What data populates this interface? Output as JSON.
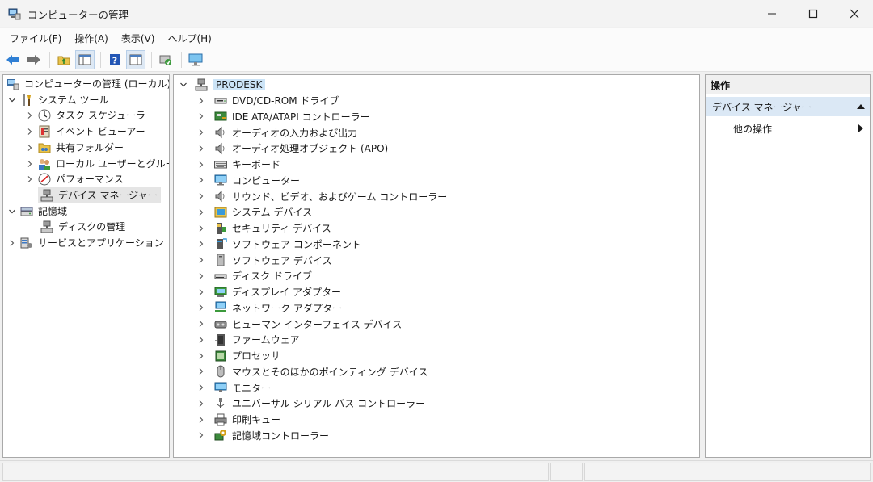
{
  "window": {
    "title": "コンピューターの管理"
  },
  "menu": [
    {
      "label": "ファイル(F)"
    },
    {
      "label": "操作(A)"
    },
    {
      "label": "表示(V)"
    },
    {
      "label": "ヘルプ(H)"
    }
  ],
  "left_tree": {
    "root": "コンピューターの管理 (ローカル)",
    "system_tools": "システム ツール",
    "task_scheduler": "タスク スケジューラ",
    "event_viewer": "イベント ビューアー",
    "shared_folders": "共有フォルダー",
    "local_users": "ローカル ユーザーとグループ",
    "performance": "パフォーマンス",
    "device_manager": "デバイス マネージャー",
    "storage": "記憶域",
    "disk_management": "ディスクの管理",
    "services_apps": "サービスとアプリケーション"
  },
  "device_tree": {
    "root": "PRODESK",
    "categories": [
      {
        "label": "DVD/CD-ROM ドライブ",
        "icon": "dvd-drive-icon"
      },
      {
        "label": "IDE ATA/ATAPI コントローラー",
        "icon": "ide-controller-icon"
      },
      {
        "label": "オーディオの入力および出力",
        "icon": "speaker-icon"
      },
      {
        "label": "オーディオ処理オブジェクト (APO)",
        "icon": "speaker-icon"
      },
      {
        "label": "キーボード",
        "icon": "keyboard-icon"
      },
      {
        "label": "コンピューター",
        "icon": "computer-icon"
      },
      {
        "label": "サウンド、ビデオ、およびゲーム コントローラー",
        "icon": "speaker-icon"
      },
      {
        "label": "システム デバイス",
        "icon": "system-device-icon"
      },
      {
        "label": "セキュリティ デバイス",
        "icon": "security-device-icon"
      },
      {
        "label": "ソフトウェア コンポーネント",
        "icon": "software-component-icon"
      },
      {
        "label": "ソフトウェア デバイス",
        "icon": "software-device-icon"
      },
      {
        "label": "ディスク ドライブ",
        "icon": "disk-drive-icon"
      },
      {
        "label": "ディスプレイ アダプター",
        "icon": "display-adapter-icon"
      },
      {
        "label": "ネットワーク アダプター",
        "icon": "network-adapter-icon"
      },
      {
        "label": "ヒューマン インターフェイス デバイス",
        "icon": "hid-icon"
      },
      {
        "label": "ファームウェア",
        "icon": "firmware-icon"
      },
      {
        "label": "プロセッサ",
        "icon": "processor-icon"
      },
      {
        "label": "マウスとそのほかのポインティング デバイス",
        "icon": "mouse-icon"
      },
      {
        "label": "モニター",
        "icon": "monitor-icon"
      },
      {
        "label": "ユニバーサル シリアル バス コントローラー",
        "icon": "usb-icon"
      },
      {
        "label": "印刷キュー",
        "icon": "printer-icon"
      },
      {
        "label": "記憶域コントローラー",
        "icon": "storage-controller-icon"
      }
    ]
  },
  "actions": {
    "header": "操作",
    "section": "デバイス マネージャー",
    "more": "他の操作"
  }
}
